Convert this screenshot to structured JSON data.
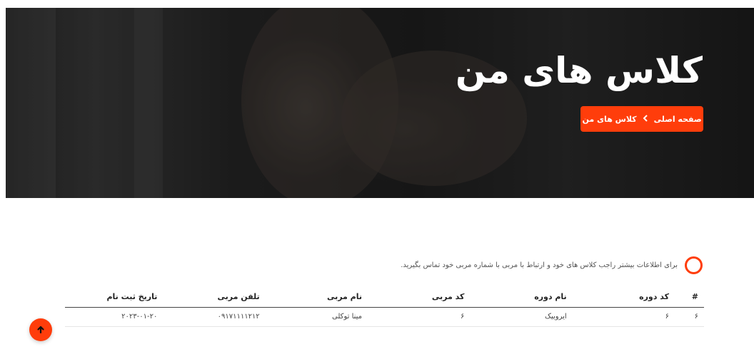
{
  "hero": {
    "title": "کلاس های من",
    "breadcrumb": {
      "home": "صفحه اصلی",
      "current": "کلاس های من"
    }
  },
  "info": {
    "text": "برای اطلاعات بیشتر راجب کلاس های خود و ارتباط با مربی با شماره مربی خود تماس بگیرید."
  },
  "table": {
    "headers": {
      "index": "#",
      "course_code": "کد دوره",
      "course_name": "نام دوره",
      "coach_code": "کد مربی",
      "coach_name": "نام مربی",
      "coach_phone": "تلفن مربی",
      "register_date": "تاریخ ثبت نام"
    },
    "rows": [
      {
        "index": "۶",
        "course_code": "۶",
        "course_name": "ایروبیک",
        "coach_code": "۶",
        "coach_name": "مینا توکلی",
        "coach_phone": "۰۹۱۷۱۱۱۱۲۱۲",
        "register_date": "۲۰۲۳-۰۱-۲۰"
      }
    ]
  },
  "colors": {
    "accent": "#ff3d0b"
  },
  "icons": {
    "breadcrumb_separator": "chevron-left-icon",
    "info": "circle-icon",
    "scroll_top": "arrow-up-icon"
  }
}
